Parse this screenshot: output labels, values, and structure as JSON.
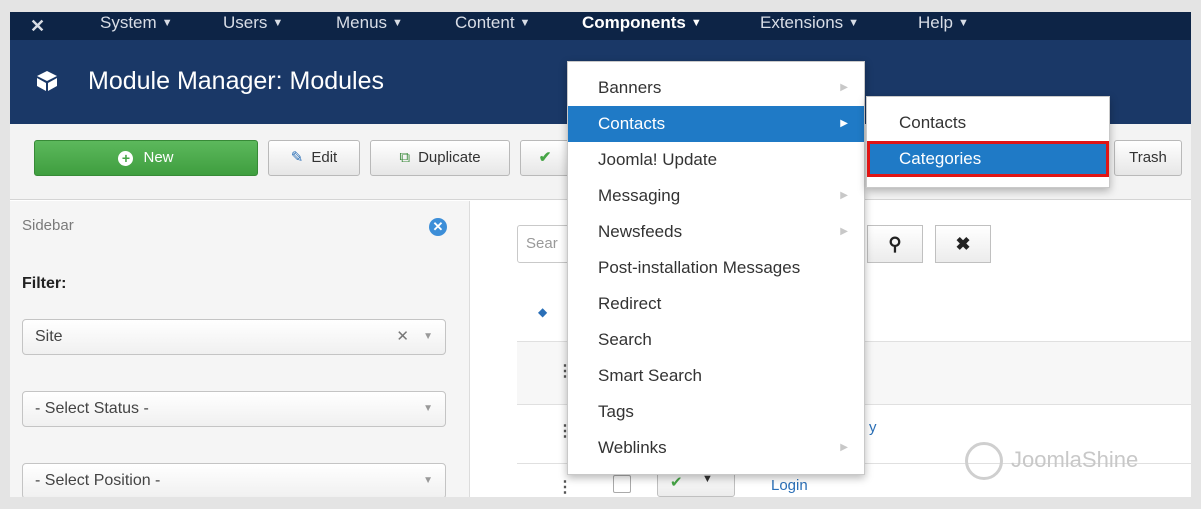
{
  "topnav": {
    "items": [
      {
        "label": "System"
      },
      {
        "label": "Users"
      },
      {
        "label": "Menus"
      },
      {
        "label": "Content"
      },
      {
        "label": "Components"
      },
      {
        "label": "Extensions"
      },
      {
        "label": "Help"
      }
    ]
  },
  "header": {
    "title": "Module Manager: Modules"
  },
  "toolbar": {
    "new_label": "New",
    "edit_label": "Edit",
    "duplicate_label": "Duplicate",
    "trash_label": "Trash"
  },
  "sidebar": {
    "title": "Sidebar",
    "filter_label": "Filter:",
    "site_select": "Site",
    "status_select": "- Select Status -",
    "position_select": "- Select Position -"
  },
  "main": {
    "search_placeholder": "Sear",
    "rows": [
      {
        "title": ""
      },
      {
        "title": "y"
      },
      {
        "title": "Login"
      }
    ]
  },
  "components_menu": {
    "items": [
      {
        "label": "Banners"
      },
      {
        "label": "Contacts"
      },
      {
        "label": "Joomla! Update"
      },
      {
        "label": "Messaging"
      },
      {
        "label": "Newsfeeds"
      },
      {
        "label": "Post-installation Messages"
      },
      {
        "label": "Redirect"
      },
      {
        "label": "Search"
      },
      {
        "label": "Smart Search"
      },
      {
        "label": "Tags"
      },
      {
        "label": "Weblinks"
      }
    ]
  },
  "contacts_submenu": {
    "items": [
      {
        "label": "Contacts"
      },
      {
        "label": "Categories"
      }
    ]
  },
  "watermark": "JoomlaShine",
  "colors": {
    "topnav": "#0d2446",
    "header": "#1a3867",
    "highlight": "#1f7ac6",
    "callout": "#e01515",
    "new_button": "#4cae4c"
  }
}
